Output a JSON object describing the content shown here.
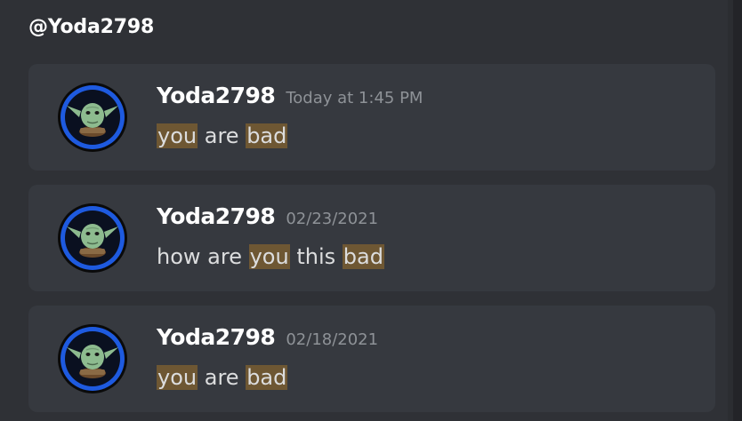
{
  "search": {
    "header": "@Yoda2798"
  },
  "results": [
    {
      "username": "Yoda2798",
      "timestamp": "Today at 1:45 PM",
      "segments": [
        {
          "text": "you",
          "highlight": true
        },
        {
          "text": " are ",
          "highlight": false
        },
        {
          "text": "bad",
          "highlight": true
        }
      ]
    },
    {
      "username": "Yoda2798",
      "timestamp": "02/23/2021",
      "segments": [
        {
          "text": "how are ",
          "highlight": false
        },
        {
          "text": "you",
          "highlight": true
        },
        {
          "text": " this ",
          "highlight": false
        },
        {
          "text": "bad",
          "highlight": true
        }
      ]
    },
    {
      "username": "Yoda2798",
      "timestamp": "02/18/2021",
      "segments": [
        {
          "text": "you",
          "highlight": true
        },
        {
          "text": " are ",
          "highlight": false
        },
        {
          "text": "bad",
          "highlight": true
        }
      ]
    }
  ],
  "colors": {
    "background": "#2f3136",
    "card": "#36393f",
    "highlight": "#6e5733",
    "username": "#ffffff",
    "timestamp": "#8e9297",
    "message": "#dcddde",
    "avatar_ring": "#1e5adf"
  },
  "icons": {
    "avatar": "yoda-avatar-icon"
  }
}
